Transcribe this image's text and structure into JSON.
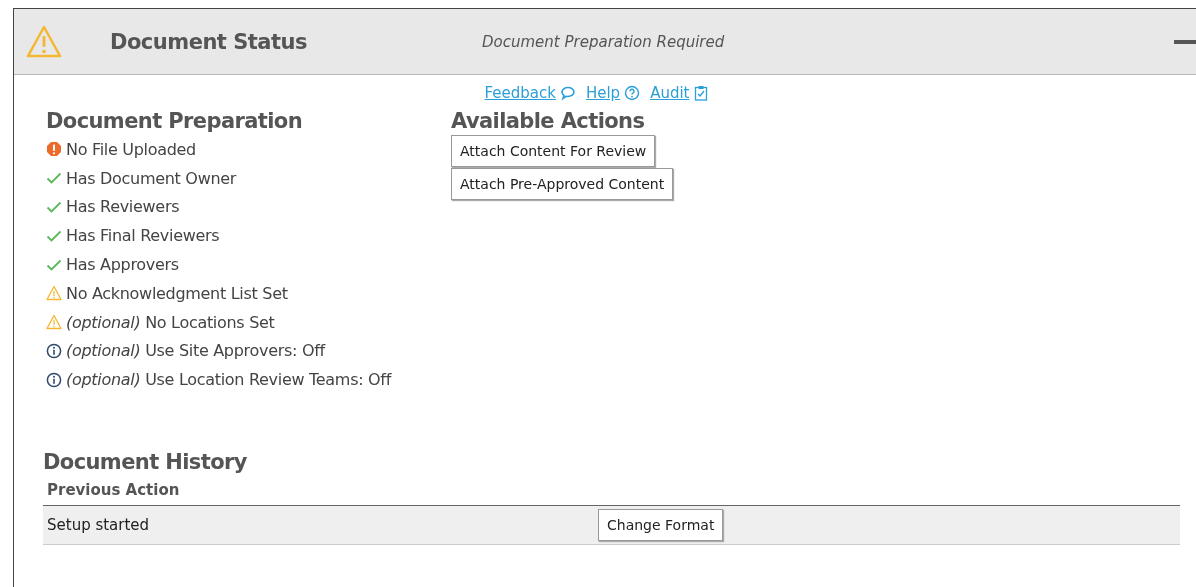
{
  "header": {
    "title": "Document Status",
    "status": "Document Preparation Required"
  },
  "links": [
    {
      "label": "Feedback",
      "kind": "feedback"
    },
    {
      "label": "Help",
      "kind": "help"
    },
    {
      "label": "Audit",
      "kind": "audit"
    }
  ],
  "preparation": {
    "heading": "Document Preparation",
    "items": [
      {
        "kind": "error",
        "text": "No File Uploaded"
      },
      {
        "kind": "ok",
        "text": "Has Document Owner"
      },
      {
        "kind": "ok",
        "text": "Has Reviewers"
      },
      {
        "kind": "ok",
        "text": "Has Final Reviewers"
      },
      {
        "kind": "ok",
        "text": "Has Approvers"
      },
      {
        "kind": "warning",
        "text": "No Acknowledgment List Set"
      },
      {
        "kind": "warning",
        "text": "*(optional)* No Locations Set"
      },
      {
        "kind": "info",
        "text": "*(optional)* Use Site Approvers: Off"
      },
      {
        "kind": "info",
        "text": "*(optional)* Use Location Review Teams: Off"
      }
    ]
  },
  "actions": {
    "heading": "Available Actions",
    "buttons": [
      "Attach Content For Review",
      "Attach Pre-Approved Content"
    ]
  },
  "history": {
    "heading": "Document History",
    "columns": [
      "Previous Action"
    ],
    "rows": [
      {
        "action": "Setup started",
        "button": "Change Format"
      }
    ]
  }
}
